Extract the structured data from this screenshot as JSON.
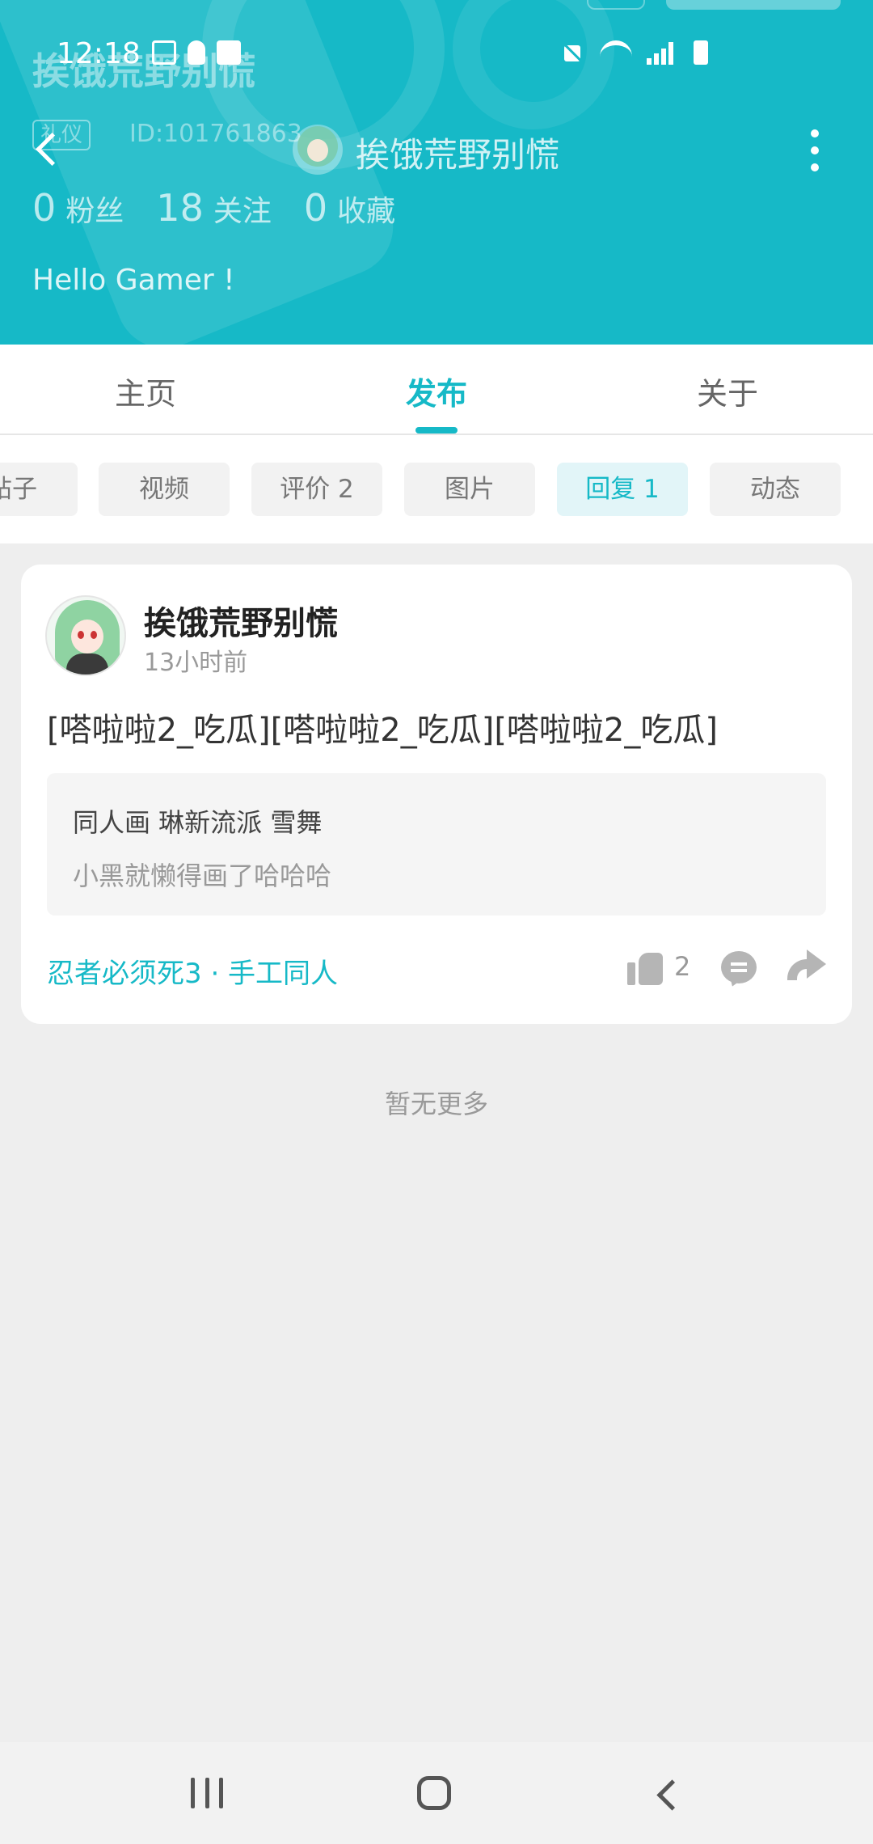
{
  "status_bar": {
    "time": "12:18"
  },
  "header": {
    "faded_title": "挨饿荒野别慌",
    "faded_tag": "礼仪",
    "faded_id": "ID:101761863",
    "name": "挨饿荒野别慌",
    "bio": "Hello Gamer !",
    "stats": [
      {
        "value": "0",
        "label": "粉丝"
      },
      {
        "value": "18",
        "label": "关注"
      },
      {
        "value": "0",
        "label": "收藏"
      }
    ]
  },
  "tabs": [
    {
      "label": "主页",
      "active": false
    },
    {
      "label": "发布",
      "active": true
    },
    {
      "label": "关于",
      "active": false
    }
  ],
  "filters": [
    {
      "label": "帖子",
      "active": false
    },
    {
      "label": "视频",
      "active": false
    },
    {
      "label": "评价 2",
      "active": false
    },
    {
      "label": "图片",
      "active": false
    },
    {
      "label": "回复 1",
      "active": true
    },
    {
      "label": "动态",
      "active": false
    }
  ],
  "post": {
    "author": "挨饿荒野别慌",
    "time": "13小时前",
    "text": "[嗒啦啦2_吃瓜][嗒啦啦2_吃瓜][嗒啦啦2_吃瓜]",
    "quote_title": "同人画 琳新流派 雪舞",
    "quote_body": "小黑就懒得画了哈哈哈",
    "tags": "忍者必须死3 · 手工同人",
    "likes": "2"
  },
  "footer_text": "暂无更多",
  "colors": {
    "accent": "#16b9c7",
    "background": "#eeeeee"
  }
}
